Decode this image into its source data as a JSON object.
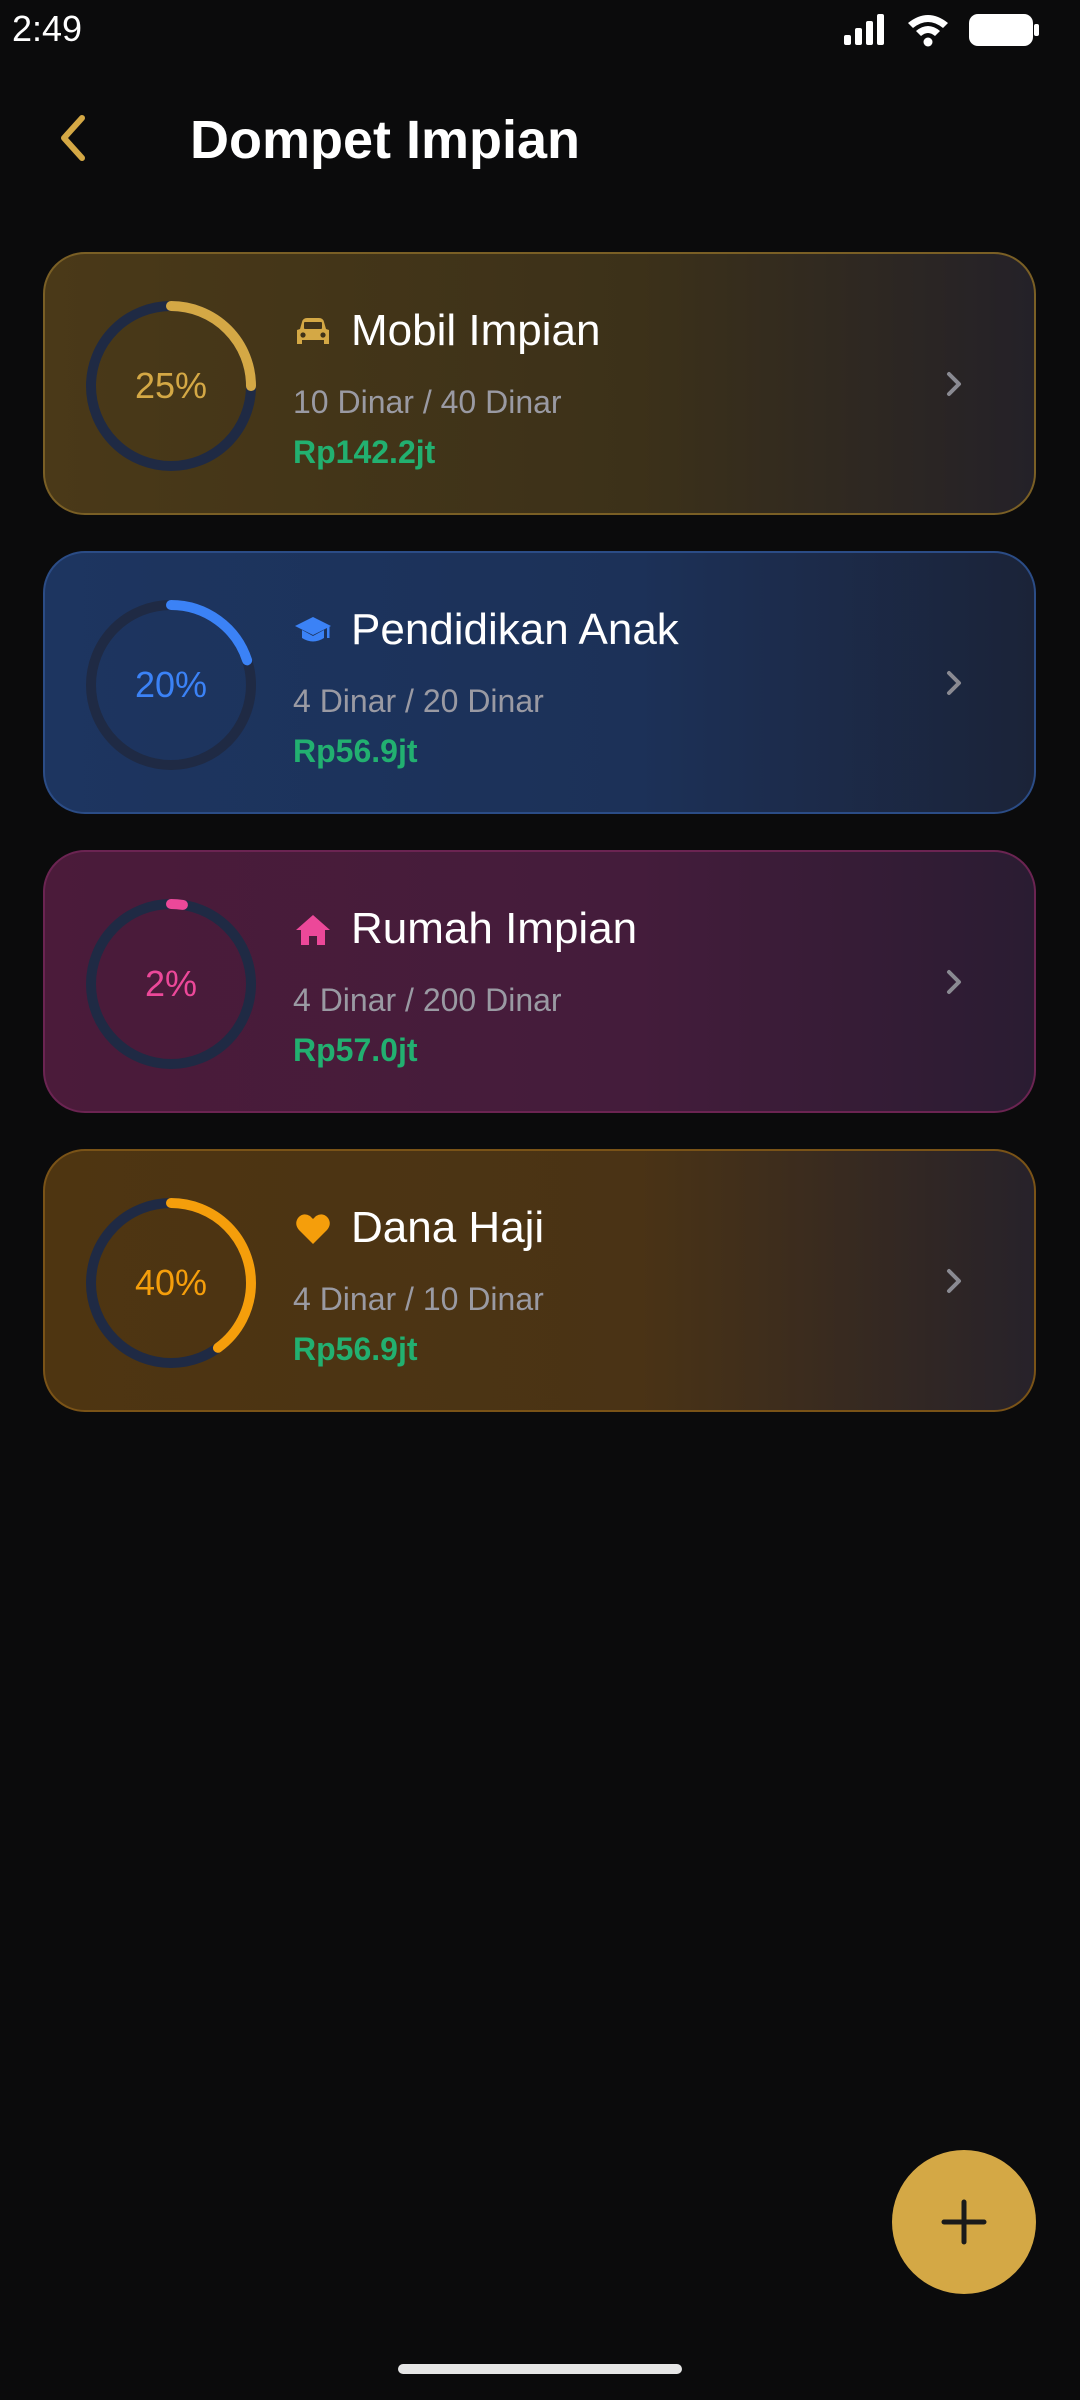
{
  "status_bar": {
    "time": "2:49"
  },
  "header": {
    "title": "Dompet Impian"
  },
  "colors": {
    "accent": "#d4a845",
    "amount_green": "#22b070",
    "ring_track": "#1f2a44"
  },
  "goals": [
    {
      "icon": "car-icon",
      "title": "Mobil Impian",
      "progress_text": "10 Dinar / 40 Dinar",
      "amount": "Rp142.2jt",
      "percent_label": "25%",
      "progress": 0.25,
      "color": "#d4a845"
    },
    {
      "icon": "graduation-cap-icon",
      "title": "Pendidikan Anak",
      "progress_text": "4 Dinar / 20 Dinar",
      "amount": "Rp56.9jt",
      "percent_label": "20%",
      "progress": 0.2,
      "color": "#3b82f6"
    },
    {
      "icon": "house-icon",
      "title": "Rumah Impian",
      "progress_text": "4 Dinar / 200 Dinar",
      "amount": "Rp57.0jt",
      "percent_label": "2%",
      "progress": 0.02,
      "color": "#ec4899"
    },
    {
      "icon": "heart-icon",
      "title": "Dana Haji",
      "progress_text": "4 Dinar / 10 Dinar",
      "amount": "Rp56.9jt",
      "percent_label": "40%",
      "progress": 0.4,
      "color": "#f59e0b"
    }
  ],
  "fab": {
    "icon": "plus-icon"
  }
}
